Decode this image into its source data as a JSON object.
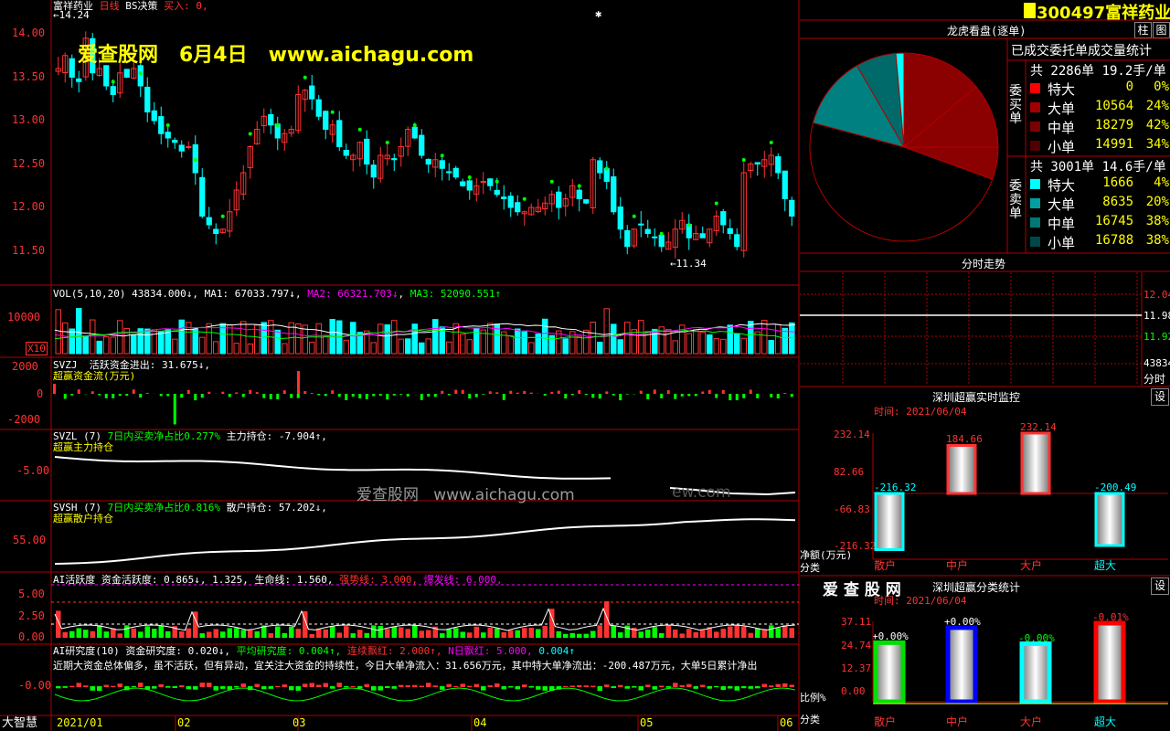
{
  "header": {
    "stock_name": "富祥药业",
    "period": "日线",
    "strategy": "BS决策",
    "buy_label": "买入: 0,",
    "high_marker": "14.24",
    "low_marker": "11.34"
  },
  "watermark": {
    "site_cn": "爱查股网",
    "date": "6月4日",
    "url": "www.aichagu.com",
    "mid_cn": "爱查股网",
    "mid_url": "www.aichagu.com",
    "mid_faded": "ew.com"
  },
  "price_axis": [
    "14.00",
    "13.50",
    "13.00",
    "12.50",
    "12.00",
    "11.50"
  ],
  "bs_marks": {
    "b": "B",
    "s": "S"
  },
  "vol": {
    "title": "VOL(5,10,20)",
    "value": "43834.000↓",
    "ma1": "MA1: 67033.797↓",
    "ma2": "MA2: 66321.703↓",
    "ma3": "MA3: 52090.551↑",
    "axis": "10000",
    "unit": "X10"
  },
  "svzj": {
    "title": "SVZJ",
    "desc": "活跃资金进出: 31.675↓,",
    "sub": "超赢资金流(万元)",
    "axis": [
      "2000",
      "0",
      "-2000"
    ]
  },
  "svzl": {
    "title": "SVZL (7)",
    "desc1": "7日内买卖净占比0.277%",
    "desc2": "主力持仓: -7.904↑,",
    "sub": "超赢主力持仓",
    "axis": "-5.00"
  },
  "svsh": {
    "title": "SVSH (7)",
    "desc1": "7日内买卖净占比0.816%",
    "desc2": "散户持仓: 57.202↓,",
    "sub": "超赢散户持仓",
    "axis": "55.00"
  },
  "ai_active": {
    "title": "AI活跃度",
    "t1": "资金活跃度: 0.865↓, 1.325,",
    "t2": "生命线: 1.560,",
    "t3": "强势线: 3.000,",
    "t4": "爆发线: 6.000,",
    "axis": [
      "5.00",
      "2.50",
      "0.00"
    ]
  },
  "ai_research": {
    "title": "AI研究度(10)",
    "t1": "资金研究度: 0.020↓,",
    "t2": "平均研究度: 0.004↑,",
    "t3": "连续飘红: 2.000↑,",
    "t4": "N日飘红: 5.000,",
    "t5": "0.004↑",
    "comment": "近期大资金总体偏多，虽不活跃，但有异动，宜关注大资金的持续性，今日大单净流入：31.656万元，其中特大单净流出：-200.487万元，大单5日累计净出",
    "axis": "-0.00"
  },
  "bottom": {
    "brand": "大智慧",
    "dates": [
      "2021/01",
      "02",
      "03",
      "04",
      "05",
      "06"
    ]
  },
  "right": {
    "code": "300497",
    "name": "富祥药业",
    "btn_a": "柱",
    "btn_b": "图",
    "order_title": "龙虎看盘(逐单)",
    "order_sub": "已成交委托单成交量统计",
    "buy_label": "委买单",
    "sell_label": "委卖单",
    "buy_total": "共 2286单 19.2手/单",
    "sell_total": "共 3001单 14.6手/单",
    "buy_rows": [
      {
        "name": "特大",
        "qty": "0",
        "pct": "0%",
        "color": "#ff0000"
      },
      {
        "name": "大单",
        "qty": "10564",
        "pct": "24%",
        "color": "#a00000"
      },
      {
        "name": "中单",
        "qty": "18279",
        "pct": "42%",
        "color": "#7a0000"
      },
      {
        "name": "小单",
        "qty": "14991",
        "pct": "34%",
        "color": "#500000"
      }
    ],
    "sell_rows": [
      {
        "name": "特大",
        "qty": "1666",
        "pct": "4%",
        "color": "#00ffff"
      },
      {
        "name": "大单",
        "qty": "8635",
        "pct": "20%",
        "color": "#00a0a0"
      },
      {
        "name": "中单",
        "qty": "16745",
        "pct": "38%",
        "color": "#007878"
      },
      {
        "name": "小单",
        "qty": "16788",
        "pct": "38%",
        "color": "#004848"
      }
    ],
    "tick_title": "分时走势",
    "tick_axis": [
      "12.04",
      "11.98",
      "11.92"
    ],
    "tick_vol": "43834",
    "tick_label": "分时",
    "monitor_title": "深圳超赢实时监控",
    "monitor_time": "时间: 2021/06/04",
    "monitor_btn": "设",
    "monitor_axis": [
      "232.14",
      "82.66",
      "-66.83",
      "-216.32"
    ],
    "monitor_unit": "净额(万元)",
    "monitor_cat": "分类",
    "monitor_values": [
      "-216.32",
      "184.66",
      "232.14",
      "-200.49"
    ],
    "categories": [
      "散户",
      "中户",
      "大户",
      "超大"
    ],
    "class_brand": "爱 查 股 网",
    "class_title": "深圳超赢分类统计",
    "class_time": "时间: 2021/06/04",
    "class_btn": "设",
    "class_axis": [
      "37.11",
      "24.74",
      "12.37",
      "0.00"
    ],
    "class_pcts": [
      "+0.00%",
      "+0.00%",
      "-0.00%",
      "-0.01%"
    ],
    "class_vals": [
      "27.9",
      "35.0",
      "27.4",
      "37.1"
    ],
    "class_ratio": "比例%",
    "class_cat": "分类",
    "colors": {
      "up": "#ff3232",
      "down": "#00ffff",
      "grid": "#b00000"
    }
  }
}
